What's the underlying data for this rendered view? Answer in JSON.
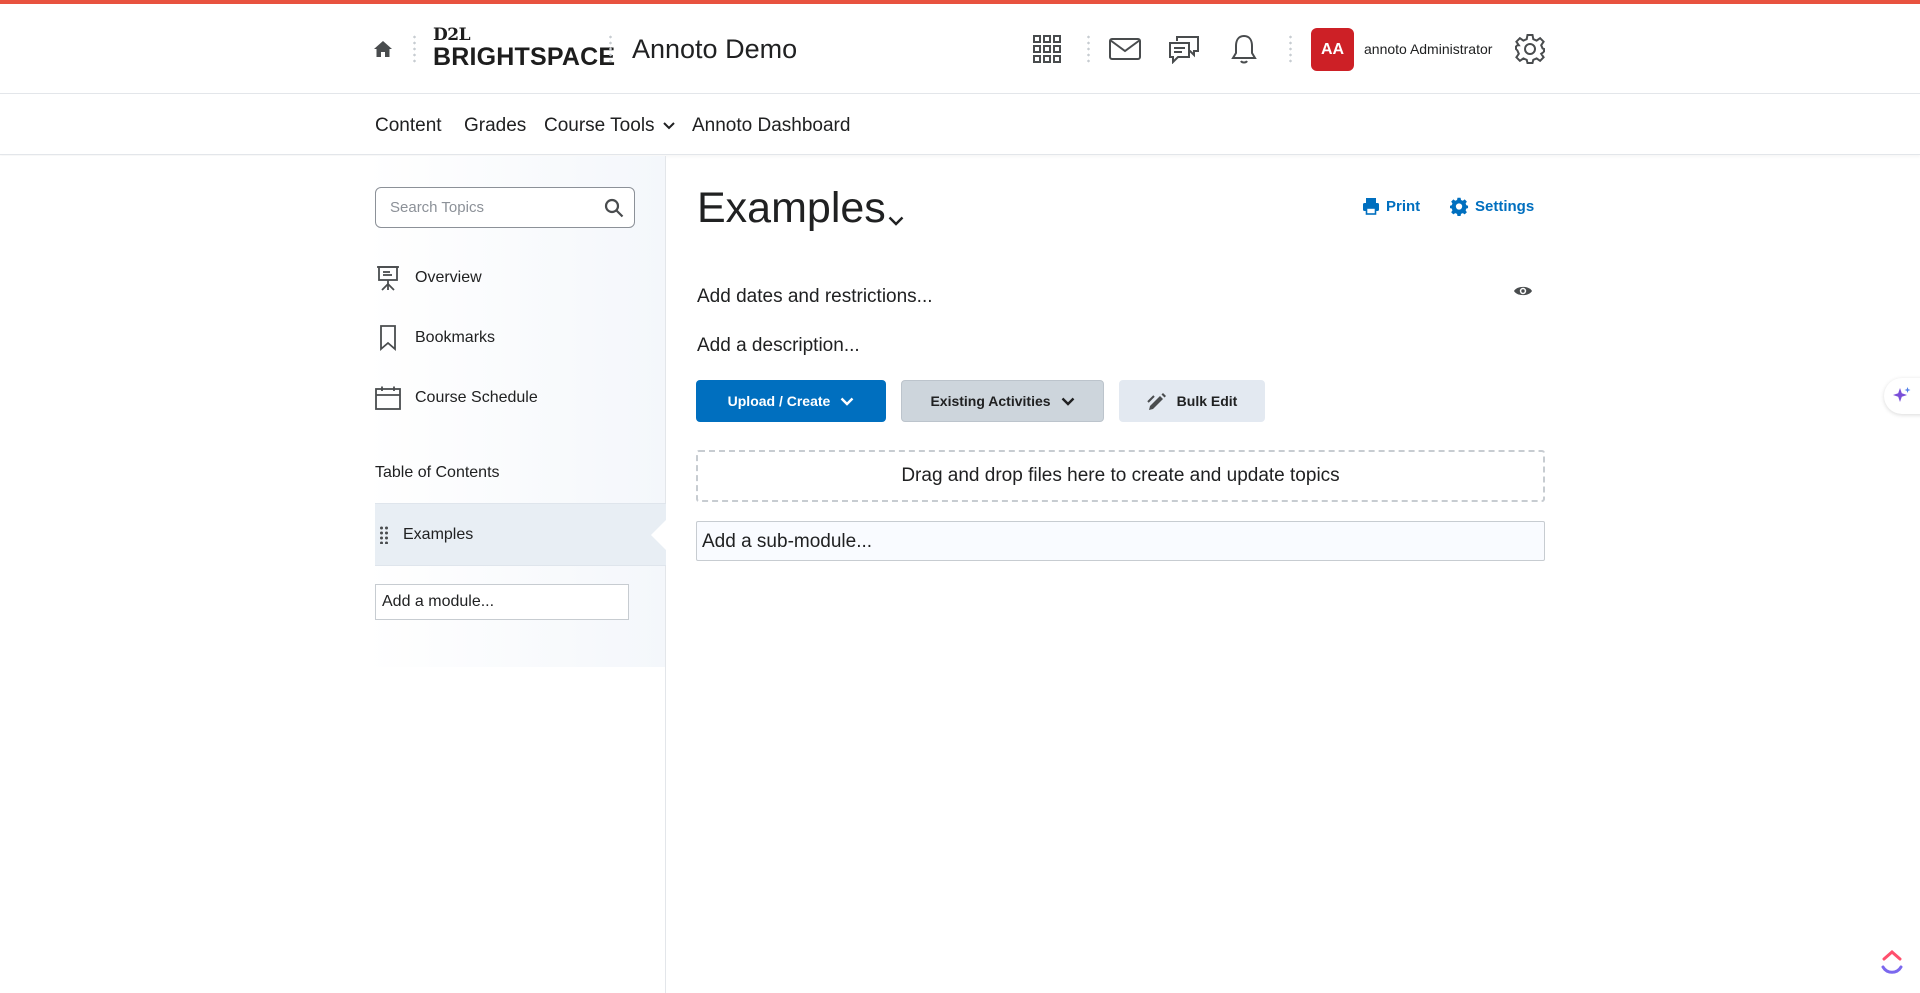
{
  "header": {
    "logo_top": "D2L",
    "logo_main": "BRIGHTSPACE",
    "org_title": "Annoto Demo",
    "avatar_initials": "AA",
    "username": "annoto Administrator"
  },
  "nav": {
    "items": [
      {
        "label": "Content"
      },
      {
        "label": "Grades"
      },
      {
        "label": "Course Tools"
      },
      {
        "label": "Annoto Dashboard"
      }
    ]
  },
  "sidebar": {
    "search_placeholder": "Search Topics",
    "links": [
      {
        "label": "Overview",
        "icon": "presentation-icon"
      },
      {
        "label": "Bookmarks",
        "icon": "bookmark-icon"
      },
      {
        "label": "Course Schedule",
        "icon": "calendar-icon"
      }
    ],
    "toc_label": "Table of Contents",
    "toc_items": [
      {
        "label": "Examples"
      }
    ],
    "add_module": "Add a module..."
  },
  "main": {
    "title": "Examples",
    "print_label": "Print",
    "settings_label": "Settings",
    "dates_text": "Add dates and restrictions...",
    "description_text": "Add a description...",
    "upload_button": "Upload / Create",
    "existing_button": "Existing Activities",
    "bulk_button": "Bulk Edit",
    "dropzone_text": "Drag and drop files here to create and update topics",
    "add_submodule": "Add a sub-module..."
  },
  "colors": {
    "accent_bar": "#e8523f",
    "primary": "#006fbf",
    "avatar": "#cd2026"
  }
}
